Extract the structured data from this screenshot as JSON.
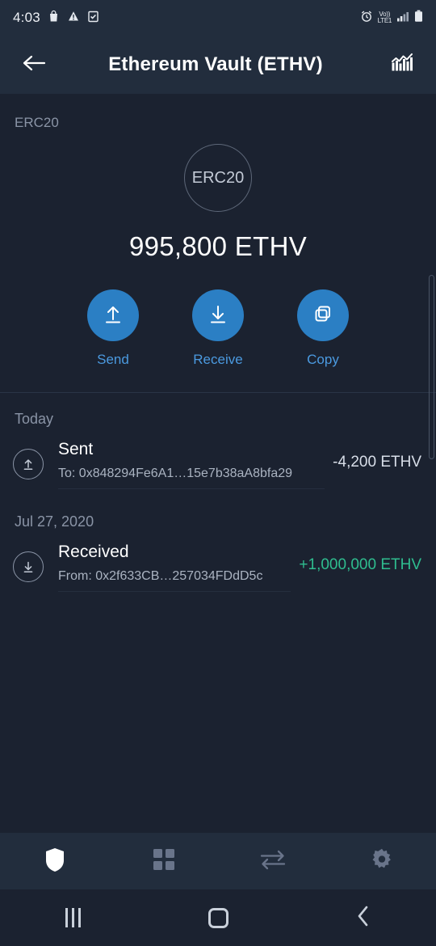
{
  "status_bar": {
    "time": "4:03",
    "left_icons": [
      "shopping-bag-icon",
      "warning-triangle-icon",
      "checkbox-icon"
    ],
    "network_volte": "Vo))",
    "network_type": "LTE1",
    "right_icons": [
      "alarm-clock-icon",
      "signal-bars-icon",
      "battery-icon"
    ]
  },
  "app_bar": {
    "back_icon": "back-arrow-icon",
    "title": "Ethereum Vault (ETHV)",
    "chart_icon": "chart-bars-icon"
  },
  "balance": {
    "standard_tag": "ERC20",
    "token_badge": "ERC20",
    "amount": "995,800 ETHV"
  },
  "actions": [
    {
      "label": "Send",
      "icon": "upload-arrow-icon"
    },
    {
      "label": "Receive",
      "icon": "download-arrow-icon"
    },
    {
      "label": "Copy",
      "icon": "copy-icon"
    }
  ],
  "transaction_groups": [
    {
      "date": "Today",
      "transactions": [
        {
          "type": "Sent",
          "icon": "send-arrow-circle-icon",
          "address": "To: 0x848294Fe6A1…15e7b38aA8bfa29",
          "amount": "-4,200 ETHV",
          "direction": "neg"
        }
      ]
    },
    {
      "date": "Jul 27, 2020",
      "transactions": [
        {
          "type": "Received",
          "icon": "receive-arrow-circle-icon",
          "address": "From: 0x2f633CB…257034FDdD5c",
          "amount": "+1,000,000 ETHV",
          "direction": "pos"
        }
      ]
    }
  ],
  "bottom_nav": [
    {
      "name": "wallet",
      "icon": "shield-icon",
      "active": true
    },
    {
      "name": "apps",
      "icon": "grid-icon",
      "active": false
    },
    {
      "name": "exchange",
      "icon": "swap-arrows-icon",
      "active": false
    },
    {
      "name": "settings",
      "icon": "gear-icon",
      "active": false
    }
  ],
  "system_nav": [
    {
      "name": "recents",
      "icon": "recents-icon"
    },
    {
      "name": "home",
      "icon": "home-circle-icon"
    },
    {
      "name": "back",
      "icon": "back-chevron-icon"
    }
  ],
  "colors": {
    "background": "#1b2230",
    "surface": "#222d3d",
    "accent": "#2b7fc4",
    "accent_text": "#4b9ae0",
    "positive": "#2fbd8f",
    "muted": "#8a94a6"
  }
}
